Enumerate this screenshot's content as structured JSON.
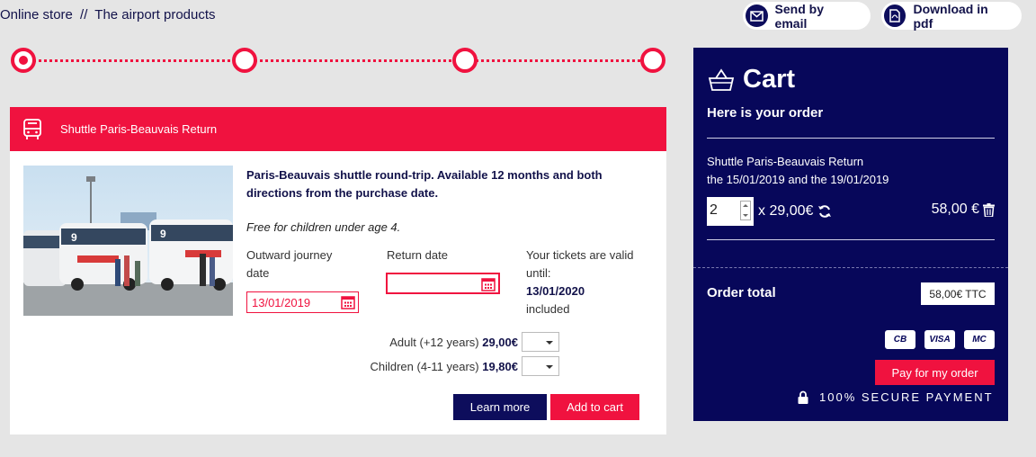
{
  "breadcrumb": {
    "root": "Online store",
    "separator": "//",
    "current": "The airport products"
  },
  "actions": {
    "email_label": "Send by email",
    "pdf_label": "Download in pdf"
  },
  "product": {
    "name": "Shuttle Paris-Beauvais Return",
    "description": "Paris-Beauvais shuttle round-trip. Available 12 months and both directions from the purchase date.",
    "note": "Free for children under age 4.",
    "outward_label": "Outward journey date",
    "outward_value": "13/01/2019",
    "return_label": "Return date",
    "return_value": "",
    "validity_label": "Your tickets are valid until:",
    "validity_date": "13/01/2020",
    "validity_suffix": "included",
    "adult_label": "Adult (+12 years)",
    "adult_price": "29,00€",
    "child_label": "Children (4-11 years)",
    "child_price": "19,80€",
    "learn_more": "Learn more",
    "add_to_cart": "Add to cart"
  },
  "cart": {
    "title": "Cart",
    "subtitle": "Here is your order",
    "item_name": "Shuttle Paris-Beauvais Return",
    "item_dates": "the 15/01/2019 and the 19/01/2019",
    "quantity": "2",
    "unit_price": "x 29,00€",
    "line_total": "58,00 €",
    "total_label": "Order total",
    "total_value": "58,00€ TTC",
    "cards": [
      "CB",
      "VISA",
      "MC"
    ],
    "pay_label": "Pay for my order",
    "secure_label": "100% SECURE PAYMENT"
  },
  "colors": {
    "accent": "#f0123f",
    "navy": "#07075a",
    "background": "#e5e5e5"
  }
}
